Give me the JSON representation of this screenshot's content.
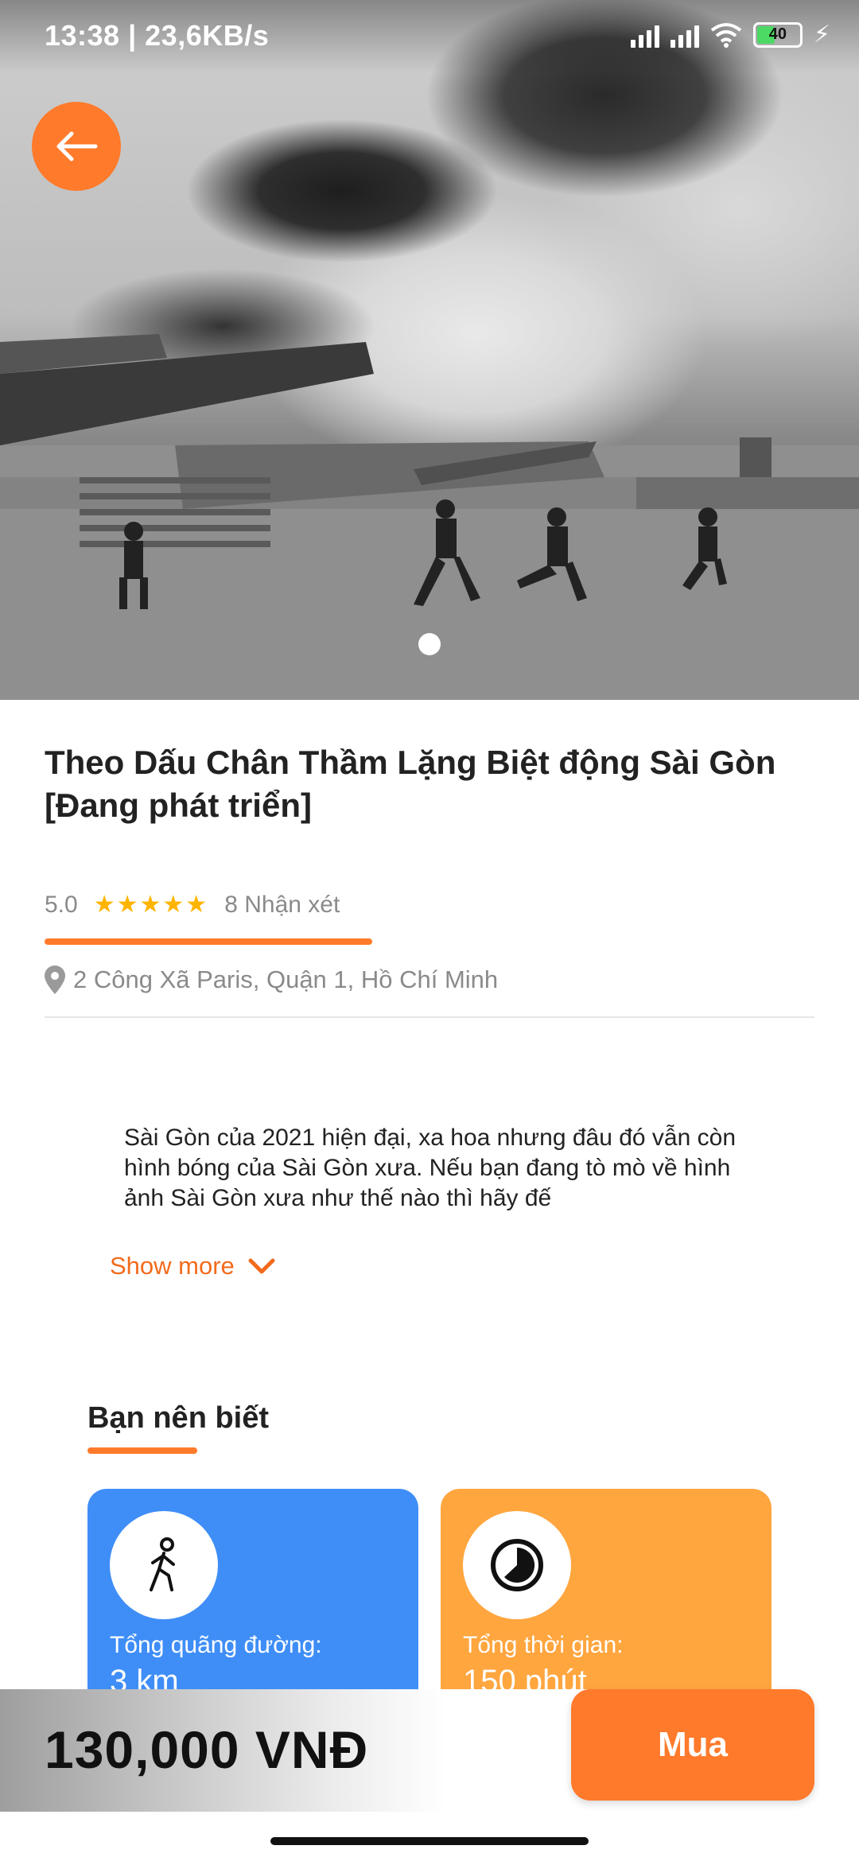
{
  "status_bar": {
    "time": "13:38 | 23,6KB/s",
    "battery": "40",
    "icons": [
      "mute-bell-icon",
      "messenger-icon",
      "signal-icon",
      "signal-icon",
      "wifi-icon",
      "battery-icon",
      "charging-icon"
    ]
  },
  "hero": {
    "back_icon": "arrow-left-icon",
    "image_description_icon": "hero-photo",
    "carousel_pages": 1
  },
  "tour": {
    "title": "Theo Dấu Chân Thầm Lặng Biệt động Sài Gòn [Đang phát triển]",
    "rating": "5.0",
    "stars": "★★★★★",
    "reviews": "8 Nhận xét",
    "address": "2 Công Xã Paris, Quận 1, Hồ Chí Minh",
    "description": "Sài Gòn của 2021 hiện đại, xa hoa nhưng đâu đó vẫn còn hình bóng của Sài Gòn xưa. Nếu bạn đang tò mò về hình ảnh Sài Gòn xưa như thế nào thì hãy đế",
    "show_more": "Show more"
  },
  "know_section": {
    "title": "Bạn nên biết",
    "cards": [
      {
        "label": "Tổng quãng đường:",
        "value": "3 km",
        "icon": "walking-person-icon",
        "color": "#3f8ef7"
      },
      {
        "label": "Tổng thời gian:",
        "value": "150 phút",
        "icon": "clock-icon",
        "color": "#ffa63f"
      }
    ]
  },
  "purchase": {
    "price": "130,000 VNĐ",
    "buy_label": "Mua"
  },
  "colors": {
    "accent": "#ff7a2b",
    "star": "#ffb400"
  }
}
